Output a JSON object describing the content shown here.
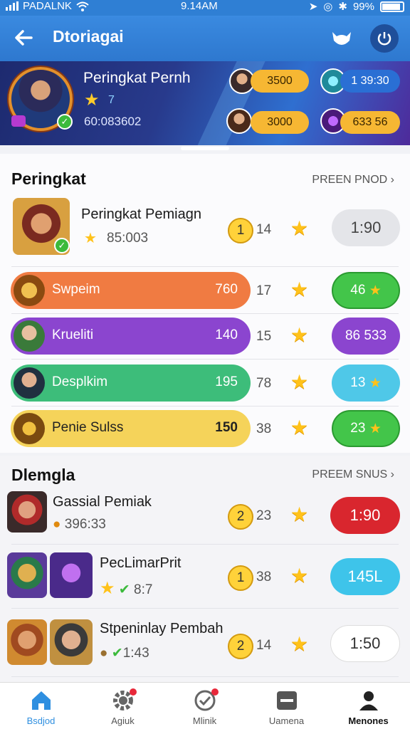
{
  "status_bar": {
    "carrier": "PADALNK",
    "time": "9.14AM",
    "battery": "99%"
  },
  "app_bar": {
    "title": "Dtoriagai"
  },
  "hero": {
    "title": "Peringkat Pernh",
    "star_value": "7",
    "score": "60:083602",
    "stats": [
      "3500",
      "1 39:30",
      "3000",
      "633 56"
    ]
  },
  "section1": {
    "title": "Peringkat",
    "link": "PREEN PNOD",
    "featured": {
      "name": "Peringkat Pemiagn",
      "sub": "85:003",
      "rank": "1",
      "count": "14",
      "time": "1:90"
    },
    "bars": [
      {
        "label": "Swpeim",
        "value": "760",
        "count": "17",
        "badge": "46",
        "color": "#f07b42"
      },
      {
        "label": "Krueliti",
        "value": "140",
        "count": "15",
        "badge": "86  533",
        "color": "#8b45cf"
      },
      {
        "label": "Desplkim",
        "value": "195",
        "count": "78",
        "badge": "13",
        "color": "#3dbd7a"
      },
      {
        "label": "Penie Sulss",
        "value": "150",
        "count": "38",
        "badge": "23",
        "color": "#f5d35a"
      }
    ]
  },
  "section2": {
    "title": "Dlemgla",
    "link": "PREEM SNUS",
    "rows": [
      {
        "name": "Gassial Pemiak",
        "sub": "396:33",
        "rank": "2",
        "count": "23",
        "action": "1:90"
      },
      {
        "name": "PecLimarPrit",
        "sub": "8:7",
        "rank": "1",
        "count": "38",
        "action": "145L"
      },
      {
        "name": "Stpeninlay Pembah",
        "sub": "1:43",
        "rank": "2",
        "count": "14",
        "action": "1:50"
      }
    ]
  },
  "tabs": [
    "Bsdjod",
    "Agiuk",
    "Mlinik",
    "Uamena",
    "Menones"
  ]
}
